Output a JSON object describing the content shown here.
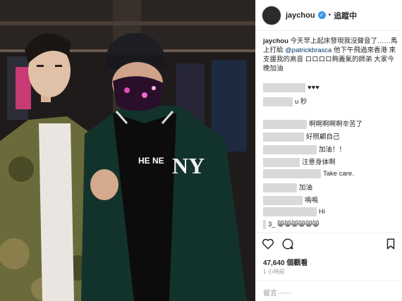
{
  "header": {
    "username": "jaychou",
    "separator": "•",
    "follow_label": "追蹤中"
  },
  "caption": {
    "username": "jaychou",
    "text_before_mention": "今天早上起床發現我沒聲音了……馬上打給",
    "mention": "@patrickbrasca",
    "text_after_mention": "他下午飛過來香港 來支援我的高音 ロロロロ夠義氣的師弟 大家今晚加油"
  },
  "comments": [
    {
      "text": "♥♥♥"
    },
    {
      "text": "u 秒"
    },
    {
      "text": "啊啊啊啊啊辛苦了"
    },
    {
      "text": "好照顧自己"
    },
    {
      "text": "加油！！"
    },
    {
      "text": "注意身体啊"
    },
    {
      "text": "Take care."
    },
    {
      "text": "加油"
    },
    {
      "text": "嗚嗚"
    },
    {
      "text": "Hi"
    },
    {
      "text": "3_ 😸😸😸😸😸😸"
    }
  ],
  "stats": {
    "views": "47,640 個觀看",
    "time": "1 小時前"
  },
  "comment_input": {
    "placeholder": "留言⋯⋯"
  },
  "photo": {
    "jacket_text": "NY",
    "shirt_text": "HE NE"
  },
  "colors": {
    "verified": "#3897f0",
    "mention": "#003569"
  },
  "icons": [
    "heart-icon",
    "comment-icon",
    "bookmark-icon",
    "verified-icon"
  ]
}
